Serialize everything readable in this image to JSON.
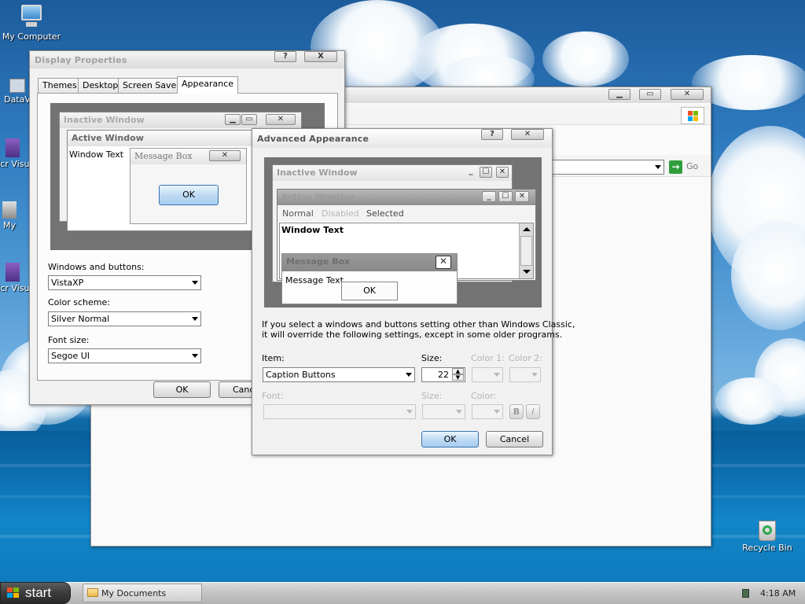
{
  "desktop": {
    "icons": [
      {
        "label": "My Computer"
      },
      {
        "label": "DataV"
      },
      {
        "label": "Micr Visua"
      },
      {
        "label": "My"
      },
      {
        "label": "Micr Visua"
      },
      {
        "label": "Recycle Bin"
      }
    ]
  },
  "display_properties": {
    "title": "Display Properties",
    "help": "?",
    "close": "X",
    "tabs": [
      "Themes",
      "Desktop",
      "Screen Saver",
      "Appearance"
    ],
    "selected_tab": "Appearance",
    "preview": {
      "inactive_window": "Inactive Window",
      "active_window": "Active Window",
      "window_text": "Window Text",
      "message_box": "Message Box",
      "ok": "OK"
    },
    "windows_and_buttons_label": "Windows and buttons:",
    "windows_and_buttons_value": "VistaXP",
    "color_scheme_label": "Color scheme:",
    "color_scheme_value": "Silver Normal",
    "font_size_label": "Font size:",
    "font_size_value": "Segoe UI",
    "ok": "OK",
    "cancel": "Canc"
  },
  "background_window": {
    "go_label": "Go"
  },
  "advanced_appearance": {
    "title": "Advanced Appearance",
    "help": "?",
    "preview": {
      "inactive_window": "Inactive Window",
      "active_window": "Active Window",
      "menu_normal": "Normal",
      "menu_disabled": "Disabled",
      "menu_selected": "Selected",
      "window_text": "Window Text",
      "message_box": "Message Box",
      "message_text": "Message Text",
      "ok": "OK"
    },
    "info_line1": "If you select a windows and buttons setting other than Windows Classic,",
    "info_line2": "it will override the following settings, except in some older programs.",
    "item_label": "Item:",
    "item_value": "Caption Buttons",
    "size_label": "Size:",
    "size_value": "22",
    "color1_label": "Color 1:",
    "color2_label": "Color 2:",
    "font_label": "Font:",
    "font_size_label": "Size:",
    "font_color_label": "Color:",
    "bold": "B",
    "italic": "I",
    "ok": "OK",
    "cancel": "Cancel"
  },
  "taskbar": {
    "start_label": "start",
    "task_label": "My Documents",
    "clock": "4:18 AM"
  },
  "colors": {
    "sky": "#2f7cc0",
    "sea": "#0b6fae",
    "preview_bg": "#737373"
  }
}
